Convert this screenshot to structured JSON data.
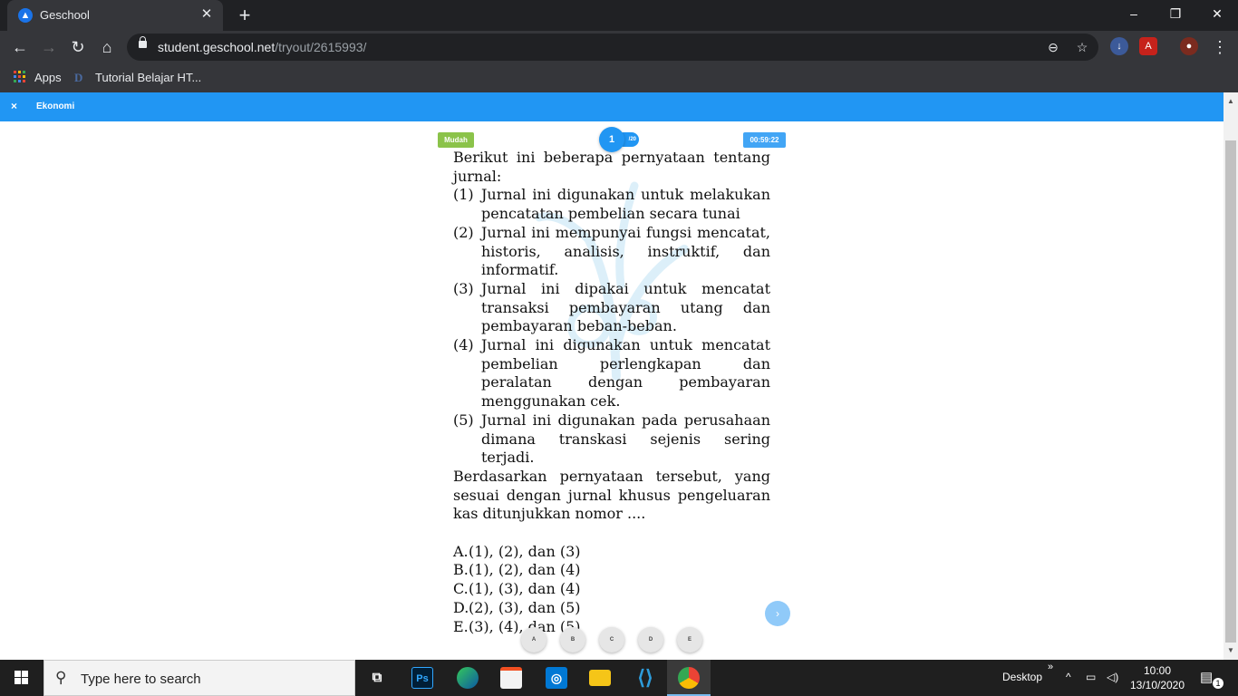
{
  "browser": {
    "tab_title": "Geschool",
    "url_domain": "student.geschool.net",
    "url_path": "/tryout/2615993/",
    "bookmarks": [
      {
        "label": "Apps"
      },
      {
        "label": "Tutorial Belajar HT..."
      }
    ]
  },
  "page": {
    "subject": "Ekonomi",
    "close_label": "×",
    "difficulty": "Mudah",
    "question_number": "1",
    "question_total": "/20",
    "timer": "00:59:22",
    "question": {
      "intro": "Berikut ini beberapa pernyataan tentang jurnal:",
      "items": [
        {
          "num": "(1)",
          "text": "Jurnal ini digunakan untuk melakukan pencatatan pembelian secara tunai"
        },
        {
          "num": "(2)",
          "text": "Jurnal ini mempunyai fungsi mencatat, historis, analisis, instruktif, dan informatif."
        },
        {
          "num": "(3)",
          "text": "Jurnal ini dipakai untuk mencatat transaksi pembayaran utang dan pembayaran beban-beban."
        },
        {
          "num": "(4)",
          "text": "Jurnal ini digunakan untuk mencatat pembelian perlengkapan dan peralatan dengan pembayaran menggunakan cek."
        },
        {
          "num": "(5)",
          "text": "Jurnal ini digunakan pada perusahaan dimana transkasi sejenis sering terjadi."
        }
      ],
      "prompt": "Berdasarkan pernyataan tersebut, yang sesuai dengan jurnal khusus pengeluaran kas ditunjukkan nomor ....",
      "options": [
        {
          "letter": "A.",
          "text": "(1), (2), dan (3)"
        },
        {
          "letter": "B.",
          "text": "(1), (2), dan (4)"
        },
        {
          "letter": "C.",
          "text": "(1), (3), dan (4)"
        },
        {
          "letter": "D.",
          "text": "(2), (3), dan (5)"
        },
        {
          "letter": "E.",
          "text": "(3), (4), dan (5)"
        }
      ]
    },
    "next_label": "›",
    "answer_buttons": [
      "A",
      "B",
      "C",
      "D",
      "E"
    ]
  },
  "taskbar": {
    "search_placeholder": "Type here to search",
    "apps": [
      "task-view",
      "photoshop",
      "edge",
      "store",
      "instagram",
      "file-explorer",
      "vscode",
      "chrome"
    ],
    "photoshop_label": "Ps",
    "desktop_label": "Desktop",
    "time": "10:00",
    "date": "13/10/2020",
    "notification_count": "1"
  },
  "colors": {
    "accent": "#2196f3",
    "difficulty_badge": "#8bc34a",
    "timer_badge": "#42a5f5",
    "chrome_dark": "#202124",
    "chrome_toolbar": "#35363a"
  }
}
